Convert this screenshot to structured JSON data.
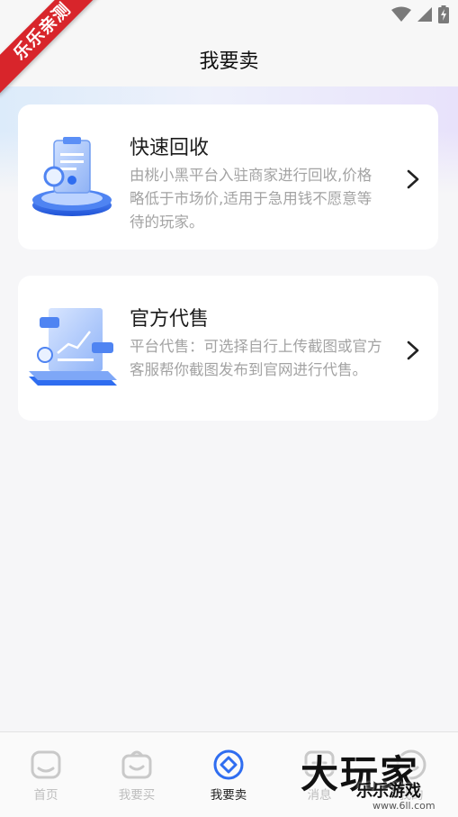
{
  "status_bar": {
    "icons": [
      "wifi-icon",
      "signal-icon",
      "battery-charging-icon"
    ]
  },
  "ribbon": {
    "text": "乐乐亲测"
  },
  "header": {
    "title": "我要卖"
  },
  "cards": [
    {
      "title": "快速回收",
      "description": "由桃小黑平台入驻商家进行回收,价格略低于市场价,适用于急用钱不愿意等待的玩家。",
      "icon": "clipboard-recycle-illustration"
    },
    {
      "title": "官方代售",
      "description": "平台代售：可选择自行上传截图或官方客服帮你截图发布到官网进行代售。",
      "icon": "chart-document-illustration"
    }
  ],
  "tabbar": {
    "items": [
      {
        "label": "首页",
        "icon": "home-icon",
        "active": false
      },
      {
        "label": "我要买",
        "icon": "shopping-bag-icon",
        "active": false
      },
      {
        "label": "我要卖",
        "icon": "sell-icon",
        "active": true
      },
      {
        "label": "消息",
        "icon": "message-icon",
        "active": false
      },
      {
        "label": "我的",
        "icon": "profile-icon",
        "active": false
      }
    ]
  },
  "watermark": {
    "main": "大玩家",
    "sub": "乐乐游戏",
    "url": "www.6ll.com"
  },
  "colors": {
    "accent": "#2f6df0",
    "ribbon": "#d8252b",
    "muted_text": "#a3a3a3",
    "inactive_tab": "#bdbdbd"
  }
}
